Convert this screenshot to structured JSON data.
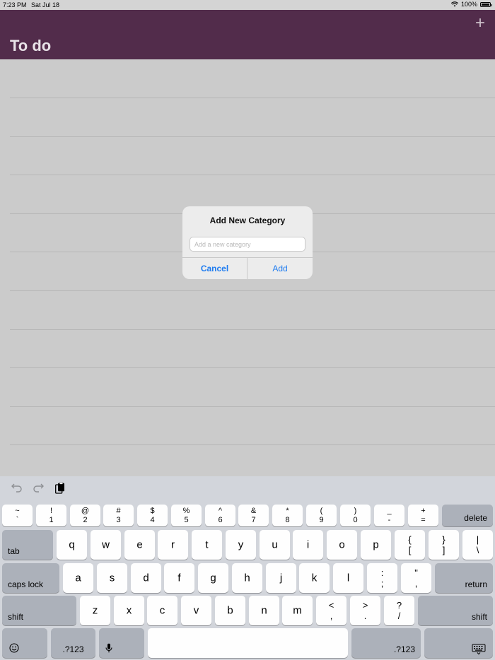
{
  "status_bar": {
    "time": "7:23 PM",
    "date": "Sat Jul 18",
    "battery": "100%"
  },
  "navbar": {
    "title": "To do",
    "add_label": "+"
  },
  "alert": {
    "title": "Add New Category",
    "placeholder": "Add a new category",
    "cancel_label": "Cancel",
    "add_label": "Add"
  },
  "keyboard": {
    "row1": [
      {
        "top": "~",
        "bot": "`"
      },
      {
        "top": "!",
        "bot": "1"
      },
      {
        "top": "@",
        "bot": "2"
      },
      {
        "top": "#",
        "bot": "3"
      },
      {
        "top": "$",
        "bot": "4"
      },
      {
        "top": "%",
        "bot": "5"
      },
      {
        "top": "^",
        "bot": "6"
      },
      {
        "top": "&",
        "bot": "7"
      },
      {
        "top": "*",
        "bot": "8"
      },
      {
        "top": "(",
        "bot": "9"
      },
      {
        "top": ")",
        "bot": "0"
      },
      {
        "top": "_",
        "bot": "-"
      },
      {
        "top": "+",
        "bot": "="
      }
    ],
    "delete_label": "delete",
    "tab_label": "tab",
    "row2": [
      "q",
      "w",
      "e",
      "r",
      "t",
      "y",
      "u",
      "i",
      "o",
      "p"
    ],
    "row2_extra": [
      {
        "top": "{",
        "bot": "["
      },
      {
        "top": "}",
        "bot": "]"
      },
      {
        "top": "|",
        "bot": "\\"
      }
    ],
    "caps_label": "caps lock",
    "row3": [
      "a",
      "s",
      "d",
      "f",
      "g",
      "h",
      "j",
      "k",
      "l"
    ],
    "row3_extra": [
      {
        "top": ":",
        "bot": ";"
      },
      {
        "top": "\"",
        "bot": ","
      }
    ],
    "return_label": "return",
    "shift_label": "shift",
    "row4": [
      "z",
      "x",
      "c",
      "v",
      "b",
      "n",
      "m"
    ],
    "row4_extra": [
      {
        "top": "<",
        "bot": ","
      },
      {
        "top": ">",
        "bot": "."
      },
      {
        "top": "?",
        "bot": "/"
      }
    ],
    "numbers_label": ".?123",
    "emoji_icon": "emoji-icon",
    "mic_icon": "microphone-icon",
    "dismiss_icon": "keyboard-dismiss-icon"
  }
}
